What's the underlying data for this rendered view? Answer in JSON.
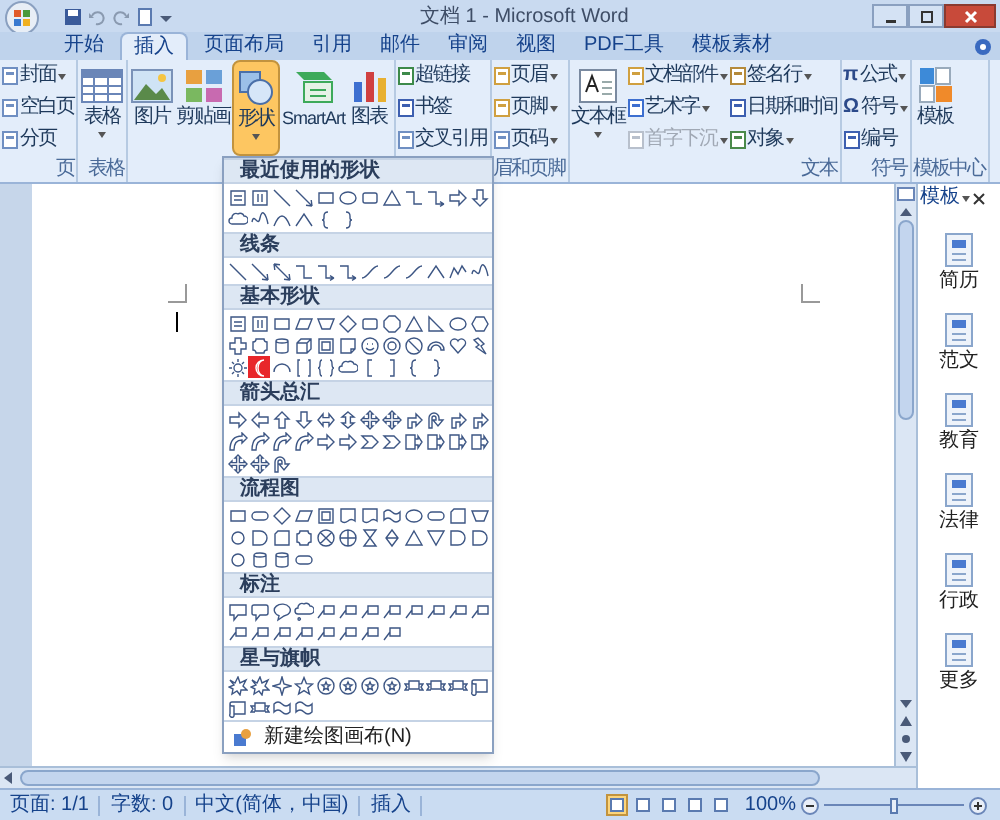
{
  "window": {
    "title": "文档 1 - Microsoft Word"
  },
  "tabs": [
    {
      "label": "开始",
      "selected": false
    },
    {
      "label": "插入",
      "selected": true
    },
    {
      "label": "页面布局",
      "selected": false
    },
    {
      "label": "引用",
      "selected": false
    },
    {
      "label": "邮件",
      "selected": false
    },
    {
      "label": "审阅",
      "selected": false
    },
    {
      "label": "视图",
      "selected": false
    },
    {
      "label": "PDF工具",
      "selected": false
    },
    {
      "label": "模板素材",
      "selected": false
    }
  ],
  "ribbon_groups": [
    {
      "label": "页",
      "buttons": [
        {
          "kind": "small",
          "label": "封面",
          "dropdown": true,
          "pressed": false,
          "disabled": false
        },
        {
          "kind": "small",
          "label": "空白页",
          "dropdown": false,
          "pressed": false,
          "disabled": false
        },
        {
          "kind": "small",
          "label": "分页",
          "dropdown": false,
          "pressed": false,
          "disabled": false
        }
      ]
    },
    {
      "label": "表格",
      "buttons": [
        {
          "kind": "large",
          "label": "表格",
          "dropdown": true,
          "pressed": false,
          "disabled": false
        }
      ]
    },
    {
      "buttons": [
        {
          "kind": "large",
          "label": "图片",
          "dropdown": false,
          "pressed": false,
          "disabled": false
        },
        {
          "kind": "large",
          "label": "剪贴画",
          "dropdown": false,
          "pressed": false,
          "disabled": false
        },
        {
          "kind": "large",
          "label": "形状",
          "dropdown": true,
          "pressed": true,
          "disabled": false
        },
        {
          "kind": "large",
          "label": "SmartArt",
          "dropdown": false,
          "pressed": false,
          "disabled": false
        },
        {
          "kind": "large",
          "label": "图表",
          "dropdown": false,
          "pressed": false,
          "disabled": false
        }
      ]
    },
    {
      "buttons": [
        {
          "kind": "small",
          "label": "超链接",
          "dropdown": false,
          "pressed": false,
          "disabled": false
        },
        {
          "kind": "small",
          "label": "书签",
          "dropdown": false,
          "pressed": false,
          "disabled": false
        },
        {
          "kind": "small",
          "label": "交叉引用",
          "dropdown": false,
          "pressed": false,
          "disabled": false
        }
      ]
    },
    {
      "label": "眉和页脚",
      "buttons": [
        {
          "kind": "small",
          "label": "页眉",
          "dropdown": true,
          "pressed": false,
          "disabled": false
        },
        {
          "kind": "small",
          "label": "页脚",
          "dropdown": true,
          "pressed": false,
          "disabled": false
        },
        {
          "kind": "small",
          "label": "页码",
          "dropdown": true,
          "pressed": false,
          "disabled": false
        }
      ]
    },
    {
      "label": "文本",
      "buttons": [
        {
          "kind": "large",
          "label": "文本框",
          "dropdown": true,
          "pressed": false,
          "disabled": false
        },
        {
          "kind": "small",
          "label": "文档部件",
          "dropdown": true,
          "pressed": false,
          "disabled": false
        },
        {
          "kind": "small",
          "label": "艺术字",
          "dropdown": true,
          "pressed": false,
          "disabled": false
        },
        {
          "kind": "small",
          "label": "首字下沉",
          "dropdown": true,
          "pressed": false,
          "disabled": true
        },
        {
          "kind": "small",
          "label": "签名行",
          "dropdown": true,
          "pressed": false,
          "disabled": false
        },
        {
          "kind": "small",
          "label": "日期和时间",
          "dropdown": false,
          "pressed": false,
          "disabled": false
        },
        {
          "kind": "small",
          "label": "对象",
          "dropdown": true,
          "pressed": false,
          "disabled": false
        }
      ]
    },
    {
      "label": "符号",
      "buttons": [
        {
          "kind": "small",
          "glyph": "π",
          "label": "公式",
          "dropdown": true,
          "pressed": false,
          "disabled": false
        },
        {
          "kind": "small",
          "glyph": "Ω",
          "label": "符号",
          "dropdown": true,
          "pressed": false,
          "disabled": false
        },
        {
          "kind": "small",
          "label": "编号",
          "dropdown": false,
          "pressed": false,
          "disabled": false
        }
      ]
    },
    {
      "label": "模板中心",
      "buttons": [
        {
          "kind": "large",
          "label": "模板",
          "dropdown": false,
          "pressed": false,
          "disabled": false
        }
      ]
    }
  ],
  "shapes_menu": {
    "sections": [
      {
        "title": "最近使用的形状",
        "shapes": [
          {
            "kind": "textbox",
            "selected": false
          },
          {
            "kind": "vtextbox",
            "selected": false
          },
          {
            "kind": "line",
            "selected": false
          },
          {
            "kind": "arrow-line",
            "selected": false
          },
          {
            "kind": "rect",
            "selected": false
          },
          {
            "kind": "oval",
            "selected": false
          },
          {
            "kind": "round-rect",
            "selected": false
          },
          {
            "kind": "triangle",
            "selected": false
          },
          {
            "kind": "elbow",
            "selected": false
          },
          {
            "kind": "elbow-arrow",
            "selected": false
          },
          {
            "kind": "arrow-r",
            "selected": false
          },
          {
            "kind": "arrow-d",
            "selected": false
          },
          {
            "kind": "cloud",
            "selected": false
          },
          {
            "kind": "scribble",
            "selected": false
          },
          {
            "kind": "curve",
            "selected": false
          },
          {
            "kind": "caret",
            "selected": false
          },
          {
            "kind": "brace-l",
            "selected": false
          },
          {
            "kind": "brace-r",
            "selected": false
          }
        ]
      },
      {
        "title": "线条",
        "shapes": [
          {
            "kind": "line",
            "selected": false
          },
          {
            "kind": "arrow-line",
            "selected": false
          },
          {
            "kind": "double-arrow",
            "selected": false
          },
          {
            "kind": "elbow",
            "selected": false
          },
          {
            "kind": "elbow-arrow",
            "selected": false
          },
          {
            "kind": "elbow-arrow",
            "selected": false
          },
          {
            "kind": "scurve",
            "selected": false
          },
          {
            "kind": "scurve",
            "selected": false
          },
          {
            "kind": "scurve",
            "selected": false
          },
          {
            "kind": "caret",
            "selected": false
          },
          {
            "kind": "freeform",
            "selected": false
          },
          {
            "kind": "scribble",
            "selected": false
          }
        ]
      },
      {
        "title": "基本形状",
        "shapes": [
          {
            "kind": "textbox",
            "selected": false
          },
          {
            "kind": "vtextbox",
            "selected": false
          },
          {
            "kind": "rect",
            "selected": false
          },
          {
            "kind": "parallelogram",
            "selected": false
          },
          {
            "kind": "trapezoid",
            "selected": false
          },
          {
            "kind": "diamond",
            "selected": false
          },
          {
            "kind": "round-rect",
            "selected": false
          },
          {
            "kind": "octagon",
            "selected": false
          },
          {
            "kind": "triangle",
            "selected": false
          },
          {
            "kind": "right-triangle",
            "selected": false
          },
          {
            "kind": "oval",
            "selected": false
          },
          {
            "kind": "hexagon",
            "selected": false
          },
          {
            "kind": "cross",
            "selected": false
          },
          {
            "kind": "plaque",
            "selected": false
          },
          {
            "kind": "cylinder",
            "selected": false
          },
          {
            "kind": "cube",
            "selected": false
          },
          {
            "kind": "frame",
            "selected": false
          },
          {
            "kind": "folded",
            "selected": false
          },
          {
            "kind": "smiley",
            "selected": false
          },
          {
            "kind": "donut",
            "selected": false
          },
          {
            "kind": "no-symbol",
            "selected": false
          },
          {
            "kind": "block-arc",
            "selected": false
          },
          {
            "kind": "heart",
            "selected": false
          },
          {
            "kind": "lightning",
            "selected": false
          },
          {
            "kind": "sun",
            "selected": false
          },
          {
            "kind": "moon",
            "selected": true
          },
          {
            "kind": "arc",
            "selected": false
          },
          {
            "kind": "double-bracket",
            "selected": false
          },
          {
            "kind": "double-brace",
            "selected": false
          },
          {
            "kind": "cloud",
            "selected": false
          },
          {
            "kind": "bracket-l",
            "selected": false
          },
          {
            "kind": "bracket-r",
            "selected": false
          },
          {
            "kind": "brace-l",
            "selected": false
          },
          {
            "kind": "brace-r",
            "selected": false
          }
        ]
      },
      {
        "title": "箭头总汇",
        "shapes": [
          {
            "kind": "arrow-r",
            "selected": false
          },
          {
            "kind": "arrow-l",
            "selected": false
          },
          {
            "kind": "arrow-u",
            "selected": false
          },
          {
            "kind": "arrow-d",
            "selected": false
          },
          {
            "kind": "arrow-lr",
            "selected": false
          },
          {
            "kind": "arrow-ud",
            "selected": false
          },
          {
            "kind": "arrow-quad",
            "selected": false
          },
          {
            "kind": "arrow-quad",
            "selected": false
          },
          {
            "kind": "bent-arrow",
            "selected": false
          },
          {
            "kind": "u-turn",
            "selected": false
          },
          {
            "kind": "bent-arrow",
            "selected": false
          },
          {
            "kind": "bent-arrow",
            "selected": false
          },
          {
            "kind": "curved-arrow",
            "selected": false
          },
          {
            "kind": "curved-arrow",
            "selected": false
          },
          {
            "kind": "curved-arrow",
            "selected": false
          },
          {
            "kind": "curved-arrow",
            "selected": false
          },
          {
            "kind": "arrow-r",
            "selected": false
          },
          {
            "kind": "arrow-r",
            "selected": false
          },
          {
            "kind": "chevron",
            "selected": false
          },
          {
            "kind": "chevron",
            "selected": false
          },
          {
            "kind": "callout-arrow",
            "selected": false
          },
          {
            "kind": "callout-arrow",
            "selected": false
          },
          {
            "kind": "callout-arrow",
            "selected": false
          },
          {
            "kind": "callout-arrow",
            "selected": false
          },
          {
            "kind": "arrow-quad",
            "selected": false
          },
          {
            "kind": "arrow-quad",
            "selected": false
          },
          {
            "kind": "u-turn",
            "selected": false
          }
        ]
      },
      {
        "title": "流程图",
        "shapes": [
          {
            "kind": "rect",
            "selected": false
          },
          {
            "kind": "terminator",
            "selected": false
          },
          {
            "kind": "diamond",
            "selected": false
          },
          {
            "kind": "parallelogram",
            "selected": false
          },
          {
            "kind": "frame",
            "selected": false
          },
          {
            "kind": "document",
            "selected": false
          },
          {
            "kind": "document",
            "selected": false
          },
          {
            "kind": "wave",
            "selected": false
          },
          {
            "kind": "oval",
            "selected": false
          },
          {
            "kind": "terminator",
            "selected": false
          },
          {
            "kind": "card",
            "selected": false
          },
          {
            "kind": "trapezoid",
            "selected": false
          },
          {
            "kind": "circle",
            "selected": false
          },
          {
            "kind": "delay",
            "selected": false
          },
          {
            "kind": "card",
            "selected": false
          },
          {
            "kind": "plaque",
            "selected": false
          },
          {
            "kind": "circle-cross",
            "selected": false
          },
          {
            "kind": "circle-plus",
            "selected": false
          },
          {
            "kind": "hourglass",
            "selected": false
          },
          {
            "kind": "sort",
            "selected": false
          },
          {
            "kind": "triangle",
            "selected": false
          },
          {
            "kind": "triangle-down",
            "selected": false
          },
          {
            "kind": "delay",
            "selected": false
          },
          {
            "kind": "delay",
            "selected": false
          },
          {
            "kind": "circle",
            "selected": false
          },
          {
            "kind": "cylinder",
            "selected": false
          },
          {
            "kind": "cylinder",
            "selected": false
          },
          {
            "kind": "terminator",
            "selected": false
          }
        ]
      },
      {
        "title": "标注",
        "shapes": [
          {
            "kind": "callout-rect",
            "selected": false
          },
          {
            "kind": "callout-round",
            "selected": false
          },
          {
            "kind": "callout-oval",
            "selected": false
          },
          {
            "kind": "callout-cloud",
            "selected": false
          },
          {
            "kind": "callout-line",
            "selected": false
          },
          {
            "kind": "callout-line",
            "selected": false
          },
          {
            "kind": "callout-line",
            "selected": false
          },
          {
            "kind": "callout-line",
            "selected": false
          },
          {
            "kind": "callout-line",
            "selected": false
          },
          {
            "kind": "callout-line",
            "selected": false
          },
          {
            "kind": "callout-line",
            "selected": false
          },
          {
            "kind": "callout-line",
            "selected": false
          },
          {
            "kind": "callout-line",
            "selected": false
          },
          {
            "kind": "callout-line",
            "selected": false
          },
          {
            "kind": "callout-line",
            "selected": false
          },
          {
            "kind": "callout-line",
            "selected": false
          },
          {
            "kind": "callout-line",
            "selected": false
          },
          {
            "kind": "callout-line",
            "selected": false
          },
          {
            "kind": "callout-line",
            "selected": false
          },
          {
            "kind": "callout-line",
            "selected": false
          }
        ]
      },
      {
        "title": "星与旗帜",
        "shapes": [
          {
            "kind": "explosion",
            "selected": false
          },
          {
            "kind": "explosion",
            "selected": false
          },
          {
            "kind": "star4",
            "selected": false
          },
          {
            "kind": "star5",
            "selected": false
          },
          {
            "kind": "seal",
            "selected": false
          },
          {
            "kind": "seal",
            "selected": false
          },
          {
            "kind": "seal",
            "selected": false
          },
          {
            "kind": "seal",
            "selected": false
          },
          {
            "kind": "ribbon",
            "selected": false
          },
          {
            "kind": "ribbon",
            "selected": false
          },
          {
            "kind": "ribbon",
            "selected": false
          },
          {
            "kind": "scroll",
            "selected": false
          },
          {
            "kind": "scroll",
            "selected": false
          },
          {
            "kind": "ribbon",
            "selected": false
          },
          {
            "kind": "wave",
            "selected": false
          },
          {
            "kind": "wave",
            "selected": false
          }
        ]
      }
    ],
    "footer": "新建绘图画布(N)"
  },
  "template_pane": {
    "title": "模板",
    "items": [
      {
        "label": "简历"
      },
      {
        "label": "范文"
      },
      {
        "label": "教育"
      },
      {
        "label": "法律"
      },
      {
        "label": "行政"
      },
      {
        "label": "更多"
      }
    ]
  },
  "status_bar": {
    "items": [
      "页面: 1/1",
      "字数: 0",
      "中文(简体，中国)",
      "插入"
    ],
    "views": [
      {
        "selected": true
      },
      {
        "selected": false
      },
      {
        "selected": false
      },
      {
        "selected": false
      },
      {
        "selected": false
      }
    ],
    "zoom": "100%",
    "zoom_level": {
      "level": 0.5
    }
  }
}
